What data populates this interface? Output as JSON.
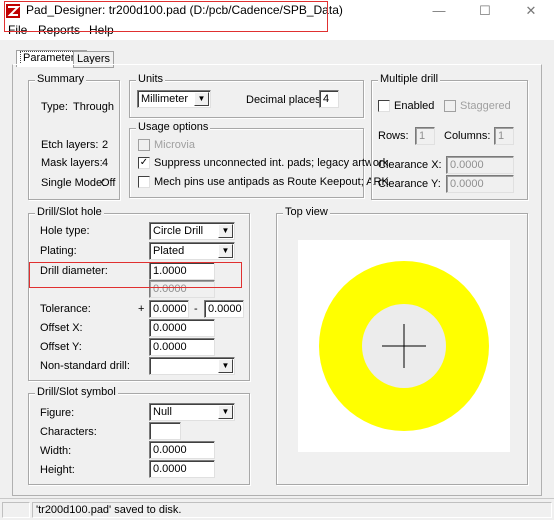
{
  "window": {
    "title": "Pad_Designer: tr200d100.pad (D:/pcb/Cadence/SPB_Data)",
    "minimize": "—",
    "maximize": "☐",
    "close": "✕"
  },
  "menu": [
    "File",
    "Reports",
    "Help"
  ],
  "tabs": [
    "Parameters",
    "Layers"
  ],
  "summary": {
    "legend": "Summary",
    "type_label": "Type:",
    "type_value": "Through",
    "etch_label": "Etch layers:",
    "etch_value": "2",
    "mask_label": "Mask layers:",
    "mask_value": "4",
    "single_label": "Single Mode:",
    "single_value": "Off"
  },
  "units": {
    "legend": "Units",
    "unit_value": "Millimeter",
    "decimal_label": "Decimal places:",
    "decimal_value": "4"
  },
  "usage": {
    "legend": "Usage options",
    "microvia": "Microvia",
    "suppress": "Suppress unconnected int. pads; legacy artwork",
    "suppress_checked": true,
    "mech": "Mech pins use antipads as Route Keepout; ARK"
  },
  "multiple_drill": {
    "legend": "Multiple drill",
    "enabled": "Enabled",
    "staggered": "Staggered",
    "rows_label": "Rows:",
    "rows_value": "1",
    "cols_label": "Columns:",
    "cols_value": "1",
    "clrx_label": "Clearance X:",
    "clrx_value": "0.0000",
    "clry_label": "Clearance Y:",
    "clry_value": "0.0000"
  },
  "drill_hole": {
    "legend": "Drill/Slot hole",
    "hole_type_label": "Hole type:",
    "hole_type_value": "Circle Drill",
    "plating_label": "Plating:",
    "plating_value": "Plated",
    "diameter_label": "Drill diameter:",
    "diameter_value": "1.0000",
    "diameter_second": "0.0000",
    "tolerance_label": "Tolerance:",
    "tol_plus": "+",
    "tol_plus_value": "0.0000",
    "tol_minus": "-",
    "tol_minus_value": "0.0000",
    "offx_label": "Offset X:",
    "offx_value": "0.0000",
    "offy_label": "Offset Y:",
    "offy_value": "0.0000",
    "nonstd_label": "Non-standard drill:",
    "nonstd_value": ""
  },
  "drill_symbol": {
    "legend": "Drill/Slot symbol",
    "figure_label": "Figure:",
    "figure_value": "Null",
    "chars_label": "Characters:",
    "chars_value": "",
    "width_label": "Width:",
    "width_value": "0.0000",
    "height_label": "Height:",
    "height_value": "0.0000"
  },
  "top_view": {
    "legend": "Top view",
    "pad_color": "#ffff00",
    "hole_color": "#ececec"
  },
  "status": "'tr200d100.pad' saved to disk."
}
